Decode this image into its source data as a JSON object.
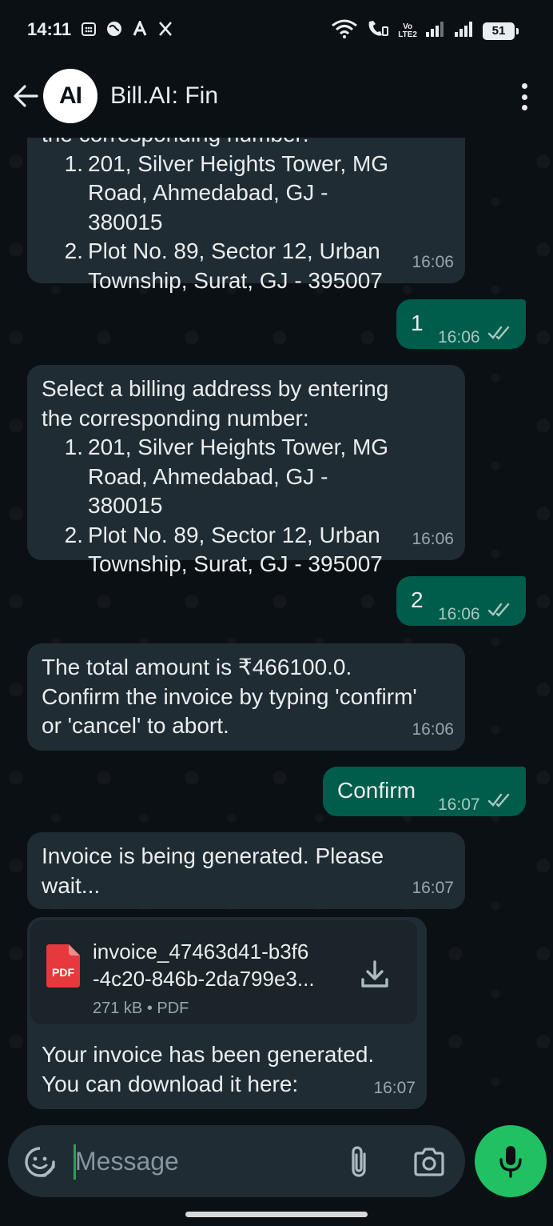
{
  "status_bar": {
    "time": "14:11",
    "network_label_top": "Vo",
    "network_label_bottom": "LTE2",
    "battery": "51"
  },
  "header": {
    "avatar_text": "AI",
    "title": "Bill.AI: Fin"
  },
  "messages": {
    "m1": {
      "partial_line": "the corresponding number:",
      "items": [
        {
          "num": "1.",
          "text": "201, Silver Heights Tower, MG Road, Ahmedabad, GJ - 380015"
        },
        {
          "num": "2.",
          "text": "Plot No. 89, Sector 12, Urban Township, Surat, GJ - 395007"
        }
      ],
      "time": "16:06"
    },
    "m2": {
      "text": "1",
      "time": "16:06"
    },
    "m3": {
      "intro": "Select a billing address by entering the corresponding number:",
      "items": [
        {
          "num": "1.",
          "text": "201, Silver Heights Tower, MG Road, Ahmedabad, GJ - 380015"
        },
        {
          "num": "2.",
          "text": "Plot No. 89, Sector 12, Urban Township, Surat, GJ - 395007"
        }
      ],
      "time": "16:06"
    },
    "m4": {
      "text": "2",
      "time": "16:06"
    },
    "m5": {
      "text": "The total amount is ₹466100.0. Confirm the invoice by typing 'confirm' or 'cancel' to abort.",
      "time": "16:06"
    },
    "m6": {
      "text": "Confirm",
      "time": "16:07"
    },
    "m7": {
      "text": "Invoice is being generated. Please wait...",
      "time": "16:07"
    },
    "m8": {
      "file_icon_label": "PDF",
      "file_name_line1": "invoice_47463d41-b3f6",
      "file_name_line2": "-4c20-846b-2da799e3...",
      "file_meta": "271 kB • PDF",
      "caption": "Your invoice has been generated. You can download it here:",
      "time": "16:07"
    }
  },
  "input": {
    "placeholder": "Message"
  },
  "colors": {
    "background": "#0b1014",
    "incoming_bubble": "#202c33",
    "outgoing_bubble": "#005c4b",
    "accent_green": "#21c063",
    "pdf_red": "#e5393d"
  },
  "icons": [
    "back-arrow-icon",
    "more-vert-icon",
    "double-check-icon",
    "pdf-file-icon",
    "download-icon",
    "emoji-sticker-icon",
    "attach-icon",
    "camera-icon",
    "mic-icon"
  ]
}
